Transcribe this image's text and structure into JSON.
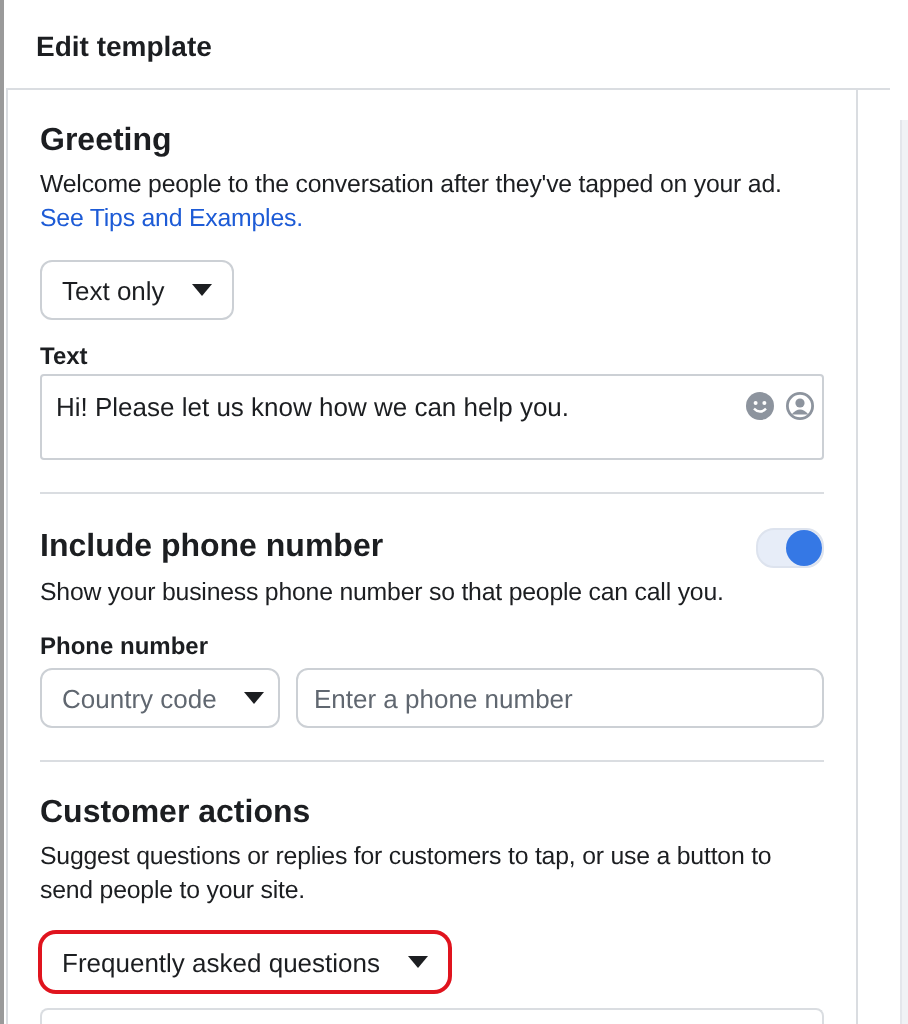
{
  "dialog": {
    "title": "Edit template"
  },
  "greeting": {
    "title": "Greeting",
    "description": "Welcome people to the conversation after they've tapped on your ad.",
    "link": "See Tips and Examples.",
    "format_dropdown": {
      "value": "Text only",
      "highlighted": false
    },
    "text_label": "Text",
    "text_value": "Hi! Please let us know how we can help you."
  },
  "phone": {
    "title": "Include phone number",
    "on": true,
    "description": "Show your business phone number so that people can call you.",
    "field_label": "Phone number",
    "country_dropdown": {
      "placeholder": "Country code",
      "highlighted": false
    },
    "number_field": {
      "placeholder": "Enter a phone number"
    }
  },
  "customer_actions": {
    "title": "Customer actions",
    "description": "Suggest questions or replies for customers to tap, or use a button to send people to your site.",
    "action_dropdown": {
      "value": "Frequently asked questions",
      "highlighted": true
    }
  }
}
